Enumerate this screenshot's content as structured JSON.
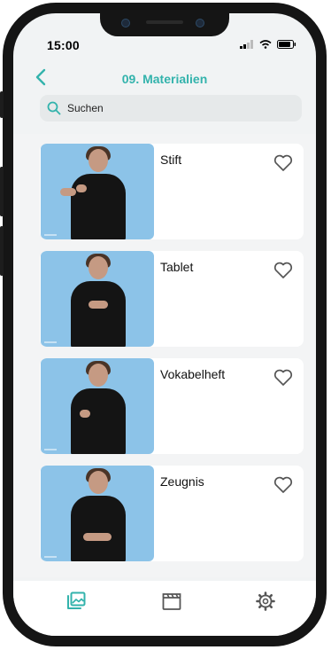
{
  "status": {
    "time": "15:00"
  },
  "header": {
    "title": "09. Materialien",
    "back_icon": "chevron-left-icon"
  },
  "search": {
    "placeholder": "Suchen",
    "value": ""
  },
  "items": [
    {
      "label": "Stift",
      "favorite": false
    },
    {
      "label": "Tablet",
      "favorite": false
    },
    {
      "label": "Vokabelheft",
      "favorite": false
    },
    {
      "label": "Zeugnis",
      "favorite": false
    }
  ],
  "tabbar": {
    "tabs": [
      {
        "icon": "gallery-icon",
        "active": true
      },
      {
        "icon": "clapperboard-icon",
        "active": false
      },
      {
        "icon": "gear-icon",
        "active": false
      }
    ]
  },
  "colors": {
    "accent": "#33b3ac",
    "thumb_bg": "#8cc3e8",
    "inactive": "#555555"
  }
}
